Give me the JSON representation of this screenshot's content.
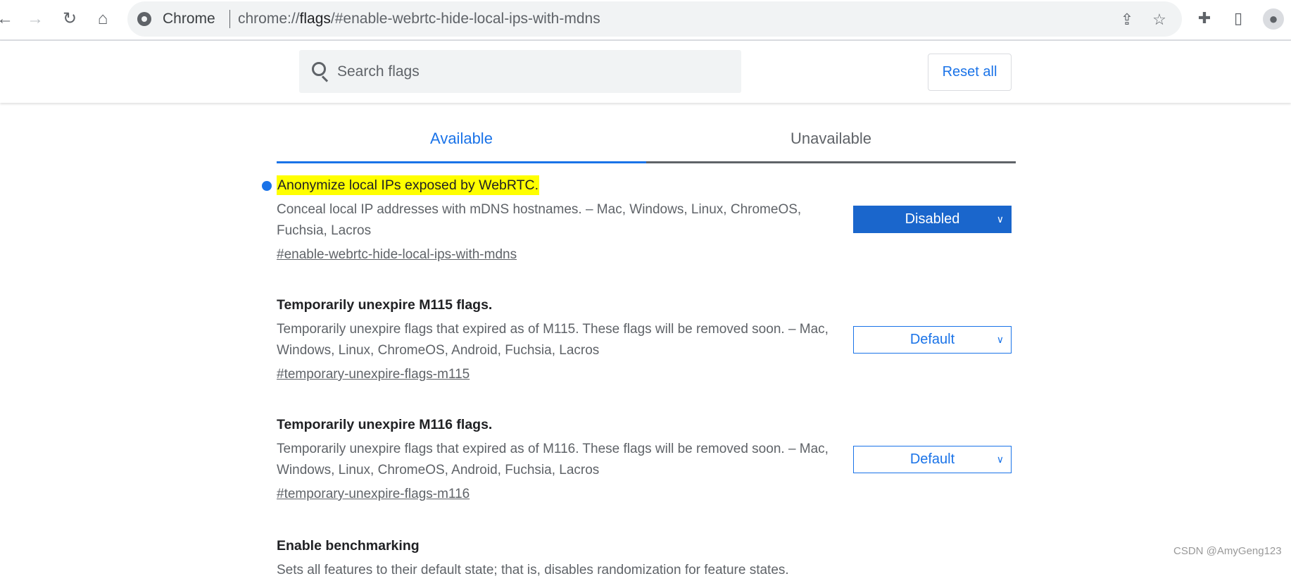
{
  "browser": {
    "site_name": "Chrome",
    "url_prefix": "chrome://",
    "url_host": "flags",
    "url_rest": "/#enable-webrtc-hide-local-ips-with-mdns"
  },
  "header": {
    "search_placeholder": "Search flags",
    "reset_label": "Reset all"
  },
  "tabs": [
    {
      "label": "Available",
      "active": true
    },
    {
      "label": "Unavailable",
      "active": false
    }
  ],
  "flags": [
    {
      "title": "Anonymize local IPs exposed by WebRTC.",
      "description": "Conceal local IP addresses with mDNS hostnames. – Mac, Windows, Linux, ChromeOS, Fuchsia, Lacros",
      "link": "#enable-webrtc-hide-local-ips-with-mdns",
      "value": "Disabled",
      "highlighted": true
    },
    {
      "title": "Temporarily unexpire M115 flags.",
      "description": "Temporarily unexpire flags that expired as of M115. These flags will be removed soon. – Mac, Windows, Linux, ChromeOS, Android, Fuchsia, Lacros",
      "link": "#temporary-unexpire-flags-m115",
      "value": "Default"
    },
    {
      "title": "Temporarily unexpire M116 flags.",
      "description": "Temporarily unexpire flags that expired as of M116. These flags will be removed soon. – Mac, Windows, Linux, ChromeOS, Android, Fuchsia, Lacros",
      "link": "#temporary-unexpire-flags-m116",
      "value": "Default"
    },
    {
      "title": "Enable benchmarking",
      "description": "Sets all features to their default state; that is, disables randomization for feature states."
    }
  ],
  "watermark": "CSDN @AmyGeng123",
  "colors": {
    "accent": "#1a73e8",
    "highlight": "#ffff00",
    "selected_enabled": "#1a66cc"
  }
}
